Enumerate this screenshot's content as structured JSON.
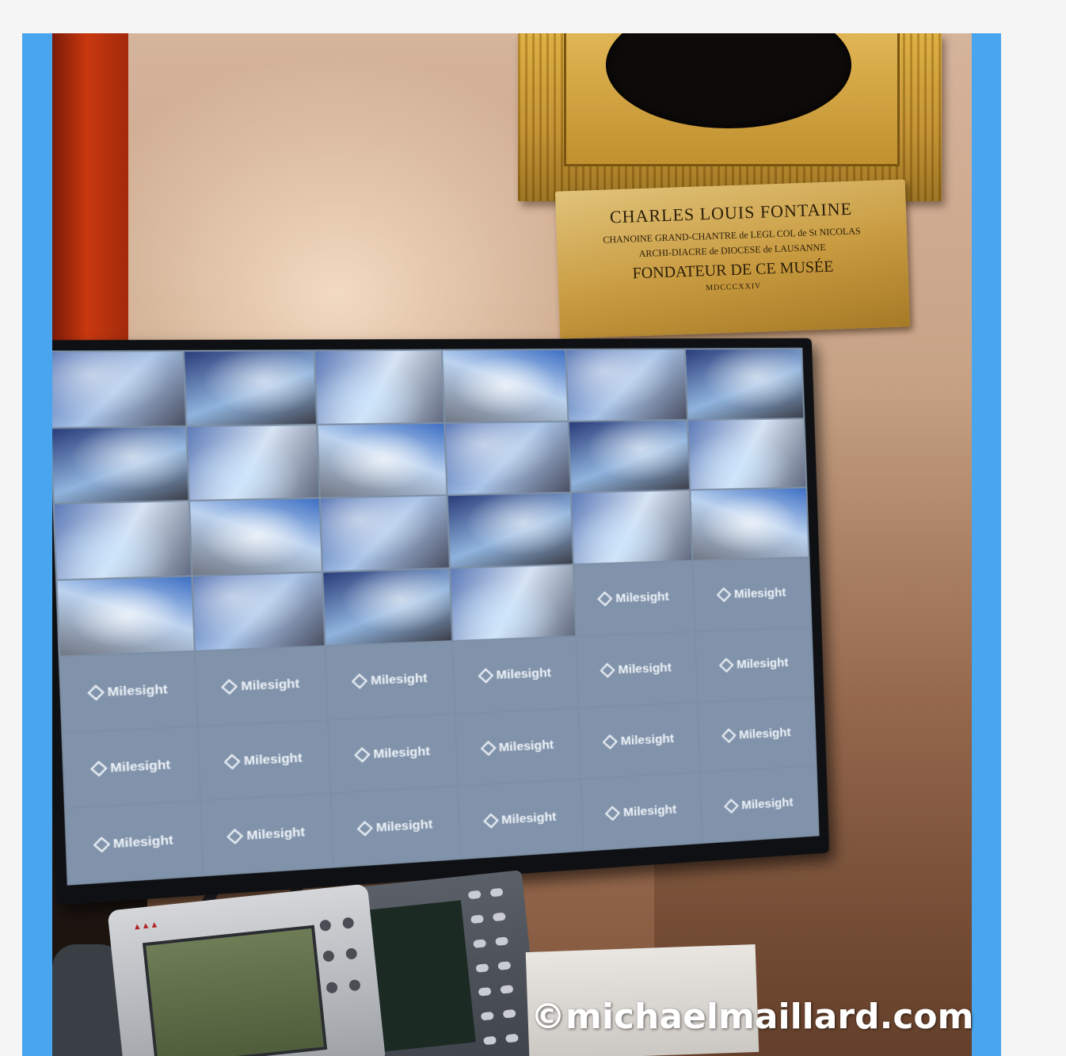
{
  "plaque": {
    "line1": "CHARLES LOUIS FONTAINE",
    "line2": "CHANOINE GRAND-CHANTRE de LEGL COL de St NICOLAS",
    "line3": "ARCHI-DIACRE de DIOCESE de LAUSANNE",
    "line4": "FONDATEUR DE CE MUSÉE",
    "line5": "MDCCCXXIV"
  },
  "monitor": {
    "grid_columns": 6,
    "grid_rows": 7,
    "camera_feed_count": 22,
    "empty_tile_logo": "Milesight"
  },
  "watermark": "©michaelmaillard.com"
}
